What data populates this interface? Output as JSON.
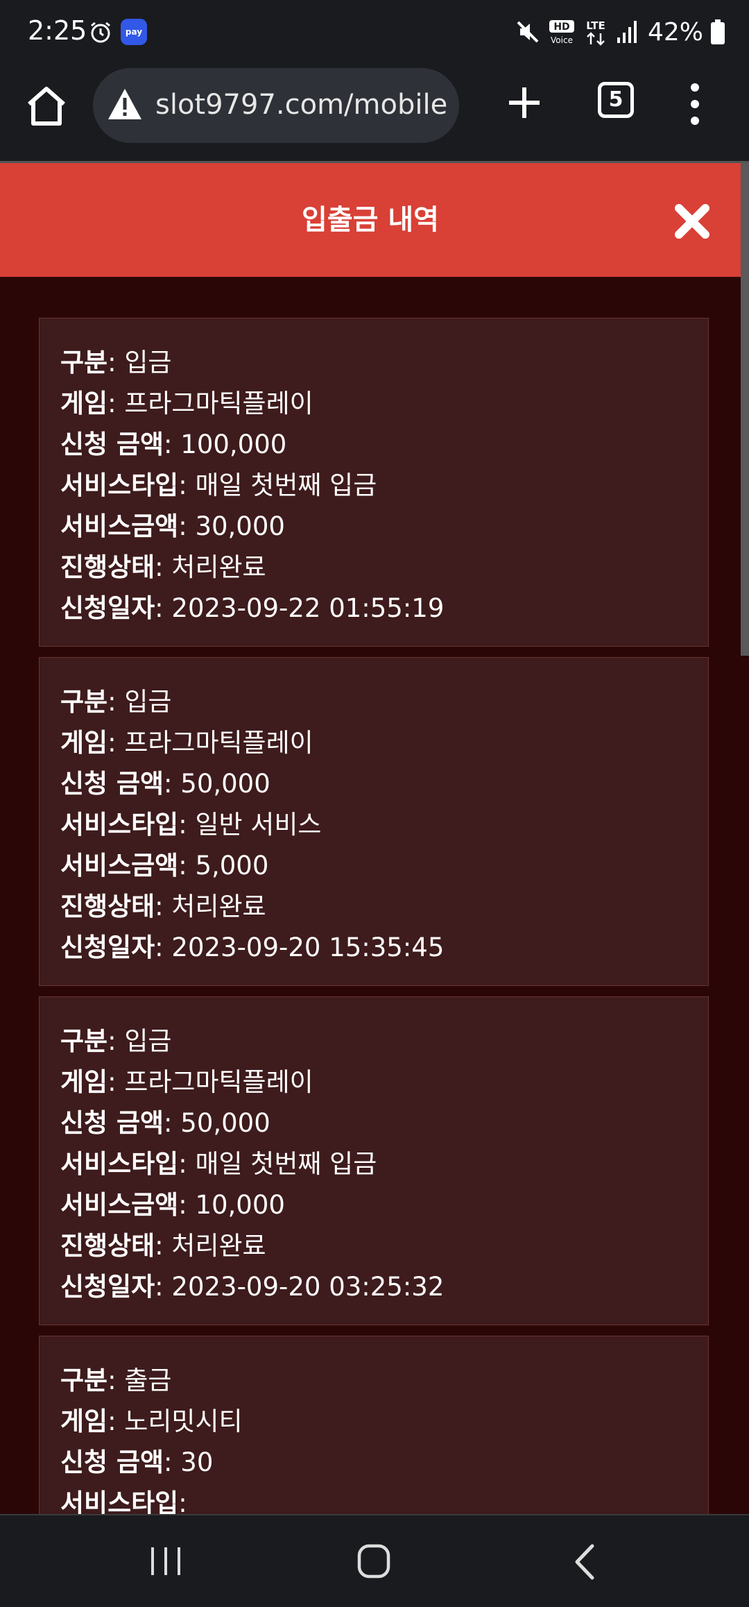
{
  "status_bar": {
    "time": "2:25",
    "pay_label": "pay",
    "hd_label": "HD",
    "voice_label": "Voice",
    "lte_label": "LTE",
    "battery": "42%",
    "icons": [
      "alarm-icon",
      "pay-icon",
      "mute-icon",
      "hd-voice-icon",
      "lte-icon",
      "signal-icon",
      "battery-icon"
    ]
  },
  "browser": {
    "url": "slot9797.com/mobile",
    "tab_count": "5",
    "icons": [
      "home-icon",
      "warning-icon",
      "plus-icon",
      "tabs-icon",
      "more-vert-icon"
    ]
  },
  "modal": {
    "title": "입출금 내역",
    "close_icon": "close-icon",
    "header_color": "#d94036"
  },
  "labels": {
    "type": "구분",
    "game": "게임",
    "amount": "신청 금액",
    "service_type": "서비스타입",
    "service_amount": "서비스금액",
    "status": "진행상태",
    "date": "신청일자"
  },
  "transactions": [
    {
      "type": "입금",
      "game": "프라그마틱플레이",
      "amount": "100,000",
      "service_type": "매일 첫번째 입금",
      "service_amount": "30,000",
      "status": "처리완료",
      "date": "2023-09-22 01:55:19"
    },
    {
      "type": "입금",
      "game": "프라그마틱플레이",
      "amount": "50,000",
      "service_type": "일반 서비스",
      "service_amount": "5,000",
      "status": "처리완료",
      "date": "2023-09-20 15:35:45"
    },
    {
      "type": "입금",
      "game": "프라그마틱플레이",
      "amount": "50,000",
      "service_type": "매일 첫번째 입금",
      "service_amount": "10,000",
      "status": "처리완료",
      "date": "2023-09-20 03:25:32"
    },
    {
      "type": "출금",
      "game": "노리밋시티",
      "amount": "30",
      "service_type": ""
    }
  ],
  "nav_bar": {
    "icons": [
      "recents-icon",
      "home-nav-icon",
      "back-icon"
    ]
  }
}
